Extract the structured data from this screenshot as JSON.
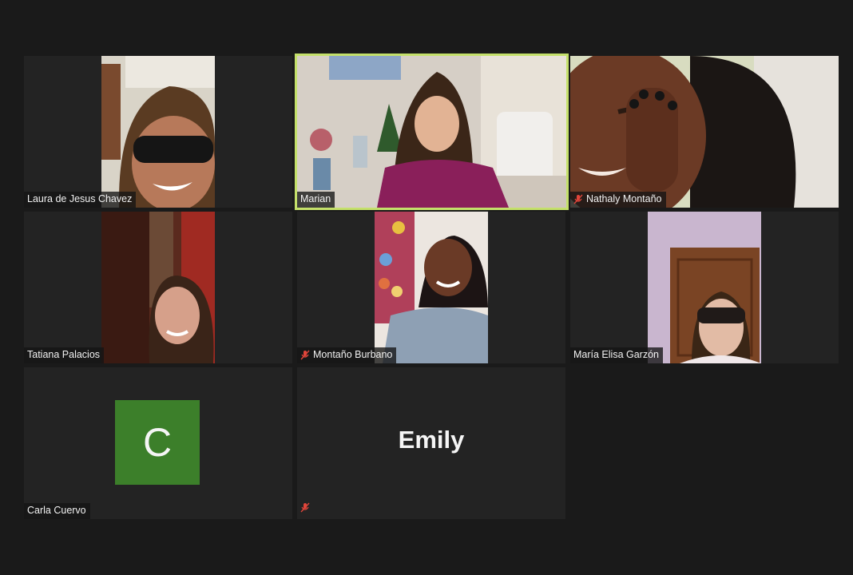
{
  "participants": [
    {
      "name": "Laura de Jesus Chavez",
      "muted": false
    },
    {
      "name": "Marian",
      "muted": false,
      "active_speaker": true
    },
    {
      "name": "Nathaly Montaño",
      "muted": true
    },
    {
      "name": "Tatiana Palacios",
      "muted": false
    },
    {
      "name": "Montaño Burbano",
      "muted": true
    },
    {
      "name": "María Elisa Garzón",
      "muted": false
    },
    {
      "name": "Carla Cuervo",
      "muted": false,
      "avatar_letter": "C",
      "avatar_color": "#3c7f2a"
    },
    {
      "name": "",
      "muted": true,
      "display_name_center": "Emily"
    }
  ],
  "colors": {
    "background": "#1a1a1a",
    "tile": "#232323",
    "active_border": "#c4e06a",
    "muted_icon": "#e0453a"
  },
  "icons": [
    "mic-muted-icon"
  ]
}
